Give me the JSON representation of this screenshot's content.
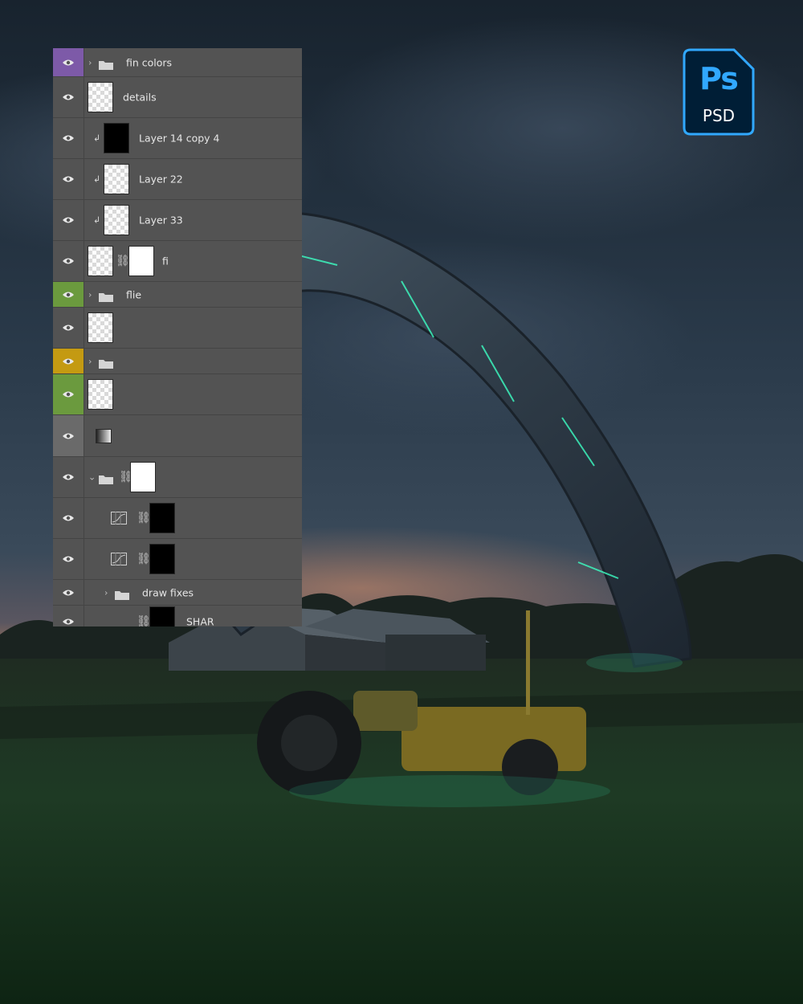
{
  "badge": {
    "brand": "Ps",
    "format": "PSD",
    "accent": "#31a8ff",
    "bg": "#001e36"
  },
  "colors": {
    "panel_bg": "#535353",
    "tag_purple": "#7d5aa8",
    "tag_green": "#6b9a3e",
    "tag_yellow": "#c49a12",
    "tag_gray": "#6a6a6a",
    "glow": "#3dffc3"
  },
  "layers": [
    {
      "name": "fin colors",
      "kind": "group",
      "tag": "purple"
    },
    {
      "name": "details",
      "kind": "layer"
    },
    {
      "name": "Layer 14 copy 4",
      "kind": "clipped",
      "thumb": "black"
    },
    {
      "name": "Layer 22",
      "kind": "clipped"
    },
    {
      "name": "Layer 33",
      "kind": "clipped"
    },
    {
      "name": "fi",
      "kind": "masked"
    },
    {
      "name": "flie",
      "kind": "group",
      "tag": "green"
    },
    {
      "name": "",
      "kind": "layer"
    },
    {
      "name": "",
      "kind": "group",
      "tag": "yellow"
    },
    {
      "name": "",
      "kind": "layer",
      "tag": "green"
    },
    {
      "name": "",
      "kind": "gradient",
      "tag": "gray"
    },
    {
      "name": "",
      "kind": "group-open"
    },
    {
      "name": "",
      "kind": "curves"
    },
    {
      "name": "",
      "kind": "curves"
    },
    {
      "name": "draw fixes",
      "kind": "subgroup"
    },
    {
      "name": "SHAR",
      "kind": "sublayer"
    }
  ]
}
